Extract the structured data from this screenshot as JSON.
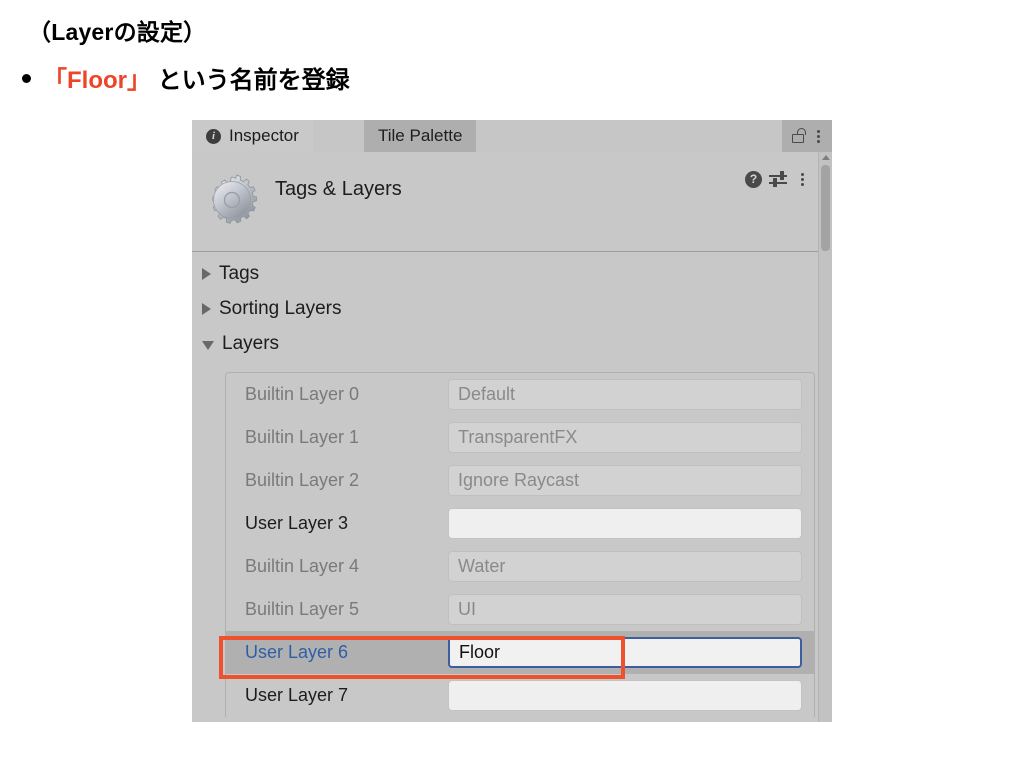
{
  "slide": {
    "title": "（Layerの設定）",
    "bullet_prefix": "「Floor」",
    "bullet_rest": " という名前を登録",
    "accent_color": "#ee4428",
    "annotation_color": "#ee512e"
  },
  "inspector": {
    "tabs": [
      {
        "label": "Inspector",
        "icon": "info-icon",
        "active": true
      },
      {
        "label": "Tile Palette",
        "icon": "",
        "active": false
      }
    ],
    "titlebar_icons": [
      {
        "name": "lock-icon"
      },
      {
        "name": "kebab-menu-icon"
      }
    ],
    "component": {
      "title": "Tags & Layers",
      "icon": "gear-icon",
      "header_icons": [
        {
          "name": "help-icon",
          "glyph": "?"
        },
        {
          "name": "preset-icon"
        },
        {
          "name": "kebab-menu-icon"
        }
      ]
    },
    "foldouts": [
      {
        "label": "Tags",
        "expanded": false
      },
      {
        "label": "Sorting Layers",
        "expanded": false
      },
      {
        "label": "Layers",
        "expanded": true
      }
    ],
    "layers": [
      {
        "label": "Builtin Layer 0",
        "value": "Default",
        "state": "disabled"
      },
      {
        "label": "Builtin Layer 1",
        "value": "TransparentFX",
        "state": "disabled"
      },
      {
        "label": "Builtin Layer 2",
        "value": "Ignore Raycast",
        "state": "disabled"
      },
      {
        "label": "User Layer 3",
        "value": "",
        "state": "editable"
      },
      {
        "label": "Builtin Layer 4",
        "value": "Water",
        "state": "disabled"
      },
      {
        "label": "Builtin Layer 5",
        "value": "UI",
        "state": "disabled"
      },
      {
        "label": "User Layer 6",
        "value": "Floor",
        "state": "focused"
      },
      {
        "label": "User Layer 7",
        "value": "",
        "state": "editable"
      }
    ]
  }
}
